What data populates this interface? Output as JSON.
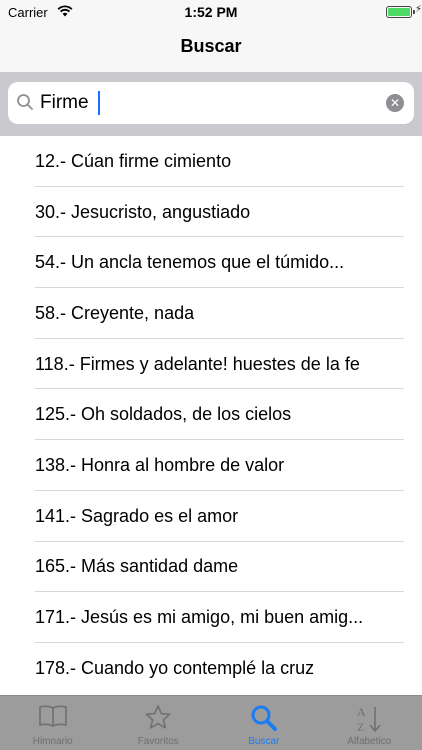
{
  "status_bar": {
    "carrier": "Carrier",
    "time": "1:52 PM"
  },
  "nav": {
    "title": "Buscar"
  },
  "search": {
    "value": "Firme",
    "placeholder": ""
  },
  "results": [
    "12.- Cúan firme cimiento",
    "30.- Jesucristo, angustiado",
    "54.- Un ancla tenemos que el túmido...",
    "58.- Creyente, nada",
    "118.- Firmes y adelante! huestes de la fe",
    "125.- Oh soldados, de los cielos",
    "138.- Honra al hombre de valor",
    "141.- Sagrado es el amor",
    "165.- Más santidad dame",
    "171.- Jesús es mi amigo, mi buen amig...",
    "178.- Cuando yo contemplé la cruz"
  ],
  "tabs": [
    {
      "label": "Himnario",
      "icon": "book-icon"
    },
    {
      "label": "Favoritos",
      "icon": "star-icon"
    },
    {
      "label": "Buscar",
      "icon": "search-icon"
    },
    {
      "label": "Alfabetico",
      "icon": "sort-az-icon"
    }
  ],
  "colors": {
    "accent": "#1b7bf0",
    "tab_bar": "#9c9c9c",
    "search_bg": "#c9c9ce",
    "battery": "#4cd964"
  }
}
